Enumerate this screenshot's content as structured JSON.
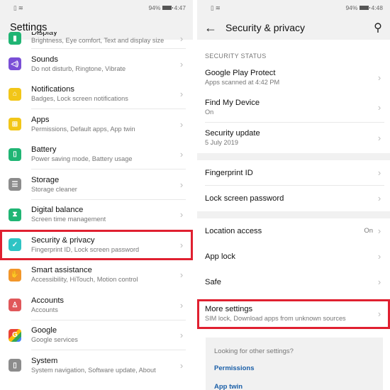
{
  "left": {
    "status": {
      "battery": "94%",
      "time": "4:47"
    },
    "title": "Settings",
    "items": [
      {
        "title": "Display",
        "subtitle": "Brightness, Eye comfort, Text and display size",
        "icon": "display-icon",
        "color": "#20b574"
      },
      {
        "title": "Sounds",
        "subtitle": "Do not disturb, Ringtone, Vibrate",
        "icon": "speaker-icon",
        "color": "#7a4fd6"
      },
      {
        "title": "Notifications",
        "subtitle": "Badges, Lock screen notifications",
        "icon": "bell-icon",
        "color": "#f2c618"
      },
      {
        "title": "Apps",
        "subtitle": "Permissions, Default apps, App twin",
        "icon": "apps-grid-icon",
        "color": "#f2c618"
      },
      {
        "title": "Battery",
        "subtitle": "Power saving mode, Battery usage",
        "icon": "battery-icon",
        "color": "#20b574"
      },
      {
        "title": "Storage",
        "subtitle": "Storage cleaner",
        "icon": "storage-icon",
        "color": "#8c8c8c"
      },
      {
        "title": "Digital balance",
        "subtitle": "Screen time management",
        "icon": "hourglass-icon",
        "color": "#20b574"
      },
      {
        "title": "Security & privacy",
        "subtitle": "Fingerprint ID, Lock screen password",
        "icon": "shield-icon",
        "color": "#2ec4c4"
      },
      {
        "title": "Smart assistance",
        "subtitle": "Accessibility, HiTouch, Motion control",
        "icon": "hand-icon",
        "color": "#f2962a"
      },
      {
        "title": "Accounts",
        "subtitle": "Accounts",
        "icon": "person-icon",
        "color": "#e0575a"
      },
      {
        "title": "Google",
        "subtitle": "Google services",
        "icon": "google-icon",
        "color": "#ea4335"
      },
      {
        "title": "System",
        "subtitle": "System navigation, Software update, About",
        "icon": "phone-icon",
        "color": "#8c8c8c"
      }
    ]
  },
  "right": {
    "status": {
      "battery": "94%",
      "time": "4:48"
    },
    "title": "Security & privacy",
    "section_label": "SECURITY STATUS",
    "status_items": [
      {
        "title": "Google Play Protect",
        "subtitle": "Apps scanned at 4:42 PM"
      },
      {
        "title": "Find My Device",
        "subtitle": "On"
      },
      {
        "title": "Security update",
        "subtitle": "5 July 2019"
      }
    ],
    "auth_items": [
      {
        "title": "Fingerprint ID"
      },
      {
        "title": "Lock screen password"
      }
    ],
    "other_items": [
      {
        "title": "Location access",
        "value": "On"
      },
      {
        "title": "App lock"
      },
      {
        "title": "Safe"
      }
    ],
    "more": {
      "title": "More settings",
      "subtitle": "SIM lock, Download apps from unknown sources"
    },
    "suggestions": {
      "question": "Looking for other settings?",
      "links": [
        "Permissions",
        "App twin"
      ]
    }
  },
  "colors": {
    "highlight": "#e02030",
    "link": "#1a5fa8"
  }
}
